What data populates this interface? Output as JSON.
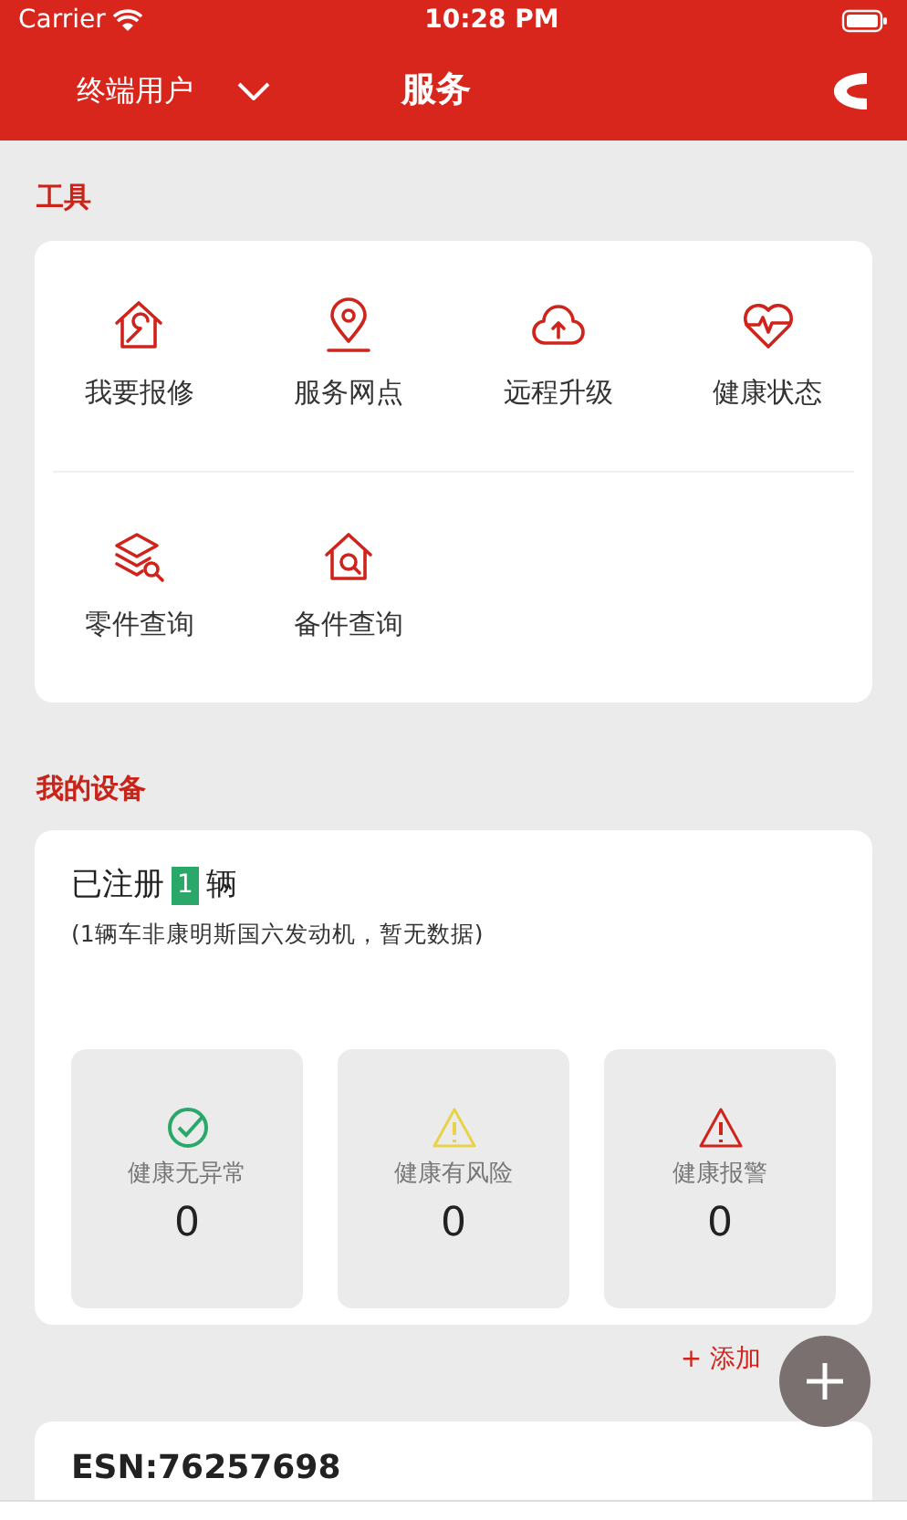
{
  "status_bar": {
    "carrier": "Carrier",
    "time": "10:28 PM"
  },
  "header": {
    "user_type": "终端用户",
    "title": "服务"
  },
  "tools": {
    "heading": "工具",
    "items": [
      {
        "label": "我要报修"
      },
      {
        "label": "服务网点"
      },
      {
        "label": "远程升级"
      },
      {
        "label": "健康状态"
      },
      {
        "label": "零件查询"
      },
      {
        "label": "备件查询"
      }
    ]
  },
  "devices": {
    "heading": "我的设备",
    "registered_prefix": "已注册",
    "registered_count": "1",
    "registered_suffix": "辆",
    "note": "(1辆车非康明斯国六发动机，暂无数据)",
    "stats": [
      {
        "kind": "ok",
        "label": "健康无异常",
        "count": "0"
      },
      {
        "kind": "risk",
        "label": "健康有风险",
        "count": "0"
      },
      {
        "kind": "alarm",
        "label": "健康报警",
        "count": "0"
      }
    ]
  },
  "add_label": "+ 添加",
  "engine": {
    "esn": "ESN:76257698"
  }
}
